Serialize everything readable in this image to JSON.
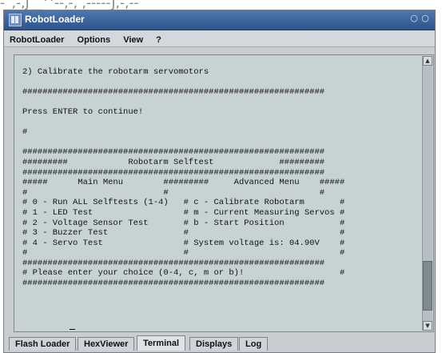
{
  "window": {
    "title": "RobotLoader",
    "minimize_glyph": "○",
    "close_glyph": "○"
  },
  "background_text": "-_,-,J__^--,-, ,-----J,-,-- ",
  "menu": [
    {
      "label": "RobotLoader"
    },
    {
      "label": "Options"
    },
    {
      "label": "View"
    },
    {
      "label": "?"
    }
  ],
  "terminal": {
    "lines": [
      "        ",
      "2) Calibrate the robotarm servomotors",
      "",
      "############################################################",
      "",
      "Press ENTER to continue!",
      "",
      "#",
      "",
      "############################################################",
      "#########            Robotarm Selftest             #########",
      "############################################################",
      "#####      Main Menu        #########     Advanced Menu    #####",
      "#                           #                              #",
      "# 0 - Run ALL Selftests (1-4)   # c - Calibrate Robotarm       #",
      "# 1 - LED Test                  # m - Current Measuring Servos #",
      "# 2 - Voltage Sensor Test       # b - Start Position           #",
      "# 3 - Buzzer Test               #                              #",
      "# 4 - Servo Test                # System voltage is: 04.90V    #",
      "#                               #                              #",
      "############################################################",
      "# Please enter your choice (0-4, c, m or b)!                   #",
      "############################################################"
    ],
    "prompt": "#",
    "scroll_position": 0.95
  },
  "tabs": [
    {
      "label": "Flash Loader",
      "active": false
    },
    {
      "label": "HexViewer",
      "active": false
    },
    {
      "label": "Terminal",
      "active": true
    },
    {
      "label": "Displays",
      "active": false
    },
    {
      "label": "Log",
      "active": false
    }
  ],
  "icons": {
    "app": "robotloader-app-icon",
    "scroll_up": "arrow-up-icon",
    "scroll_down": "arrow-down-icon"
  },
  "colors": {
    "titlebar": "#3a6299",
    "terminal_bg": "#c7d2d4",
    "window_bg": "#c9ccd0"
  }
}
